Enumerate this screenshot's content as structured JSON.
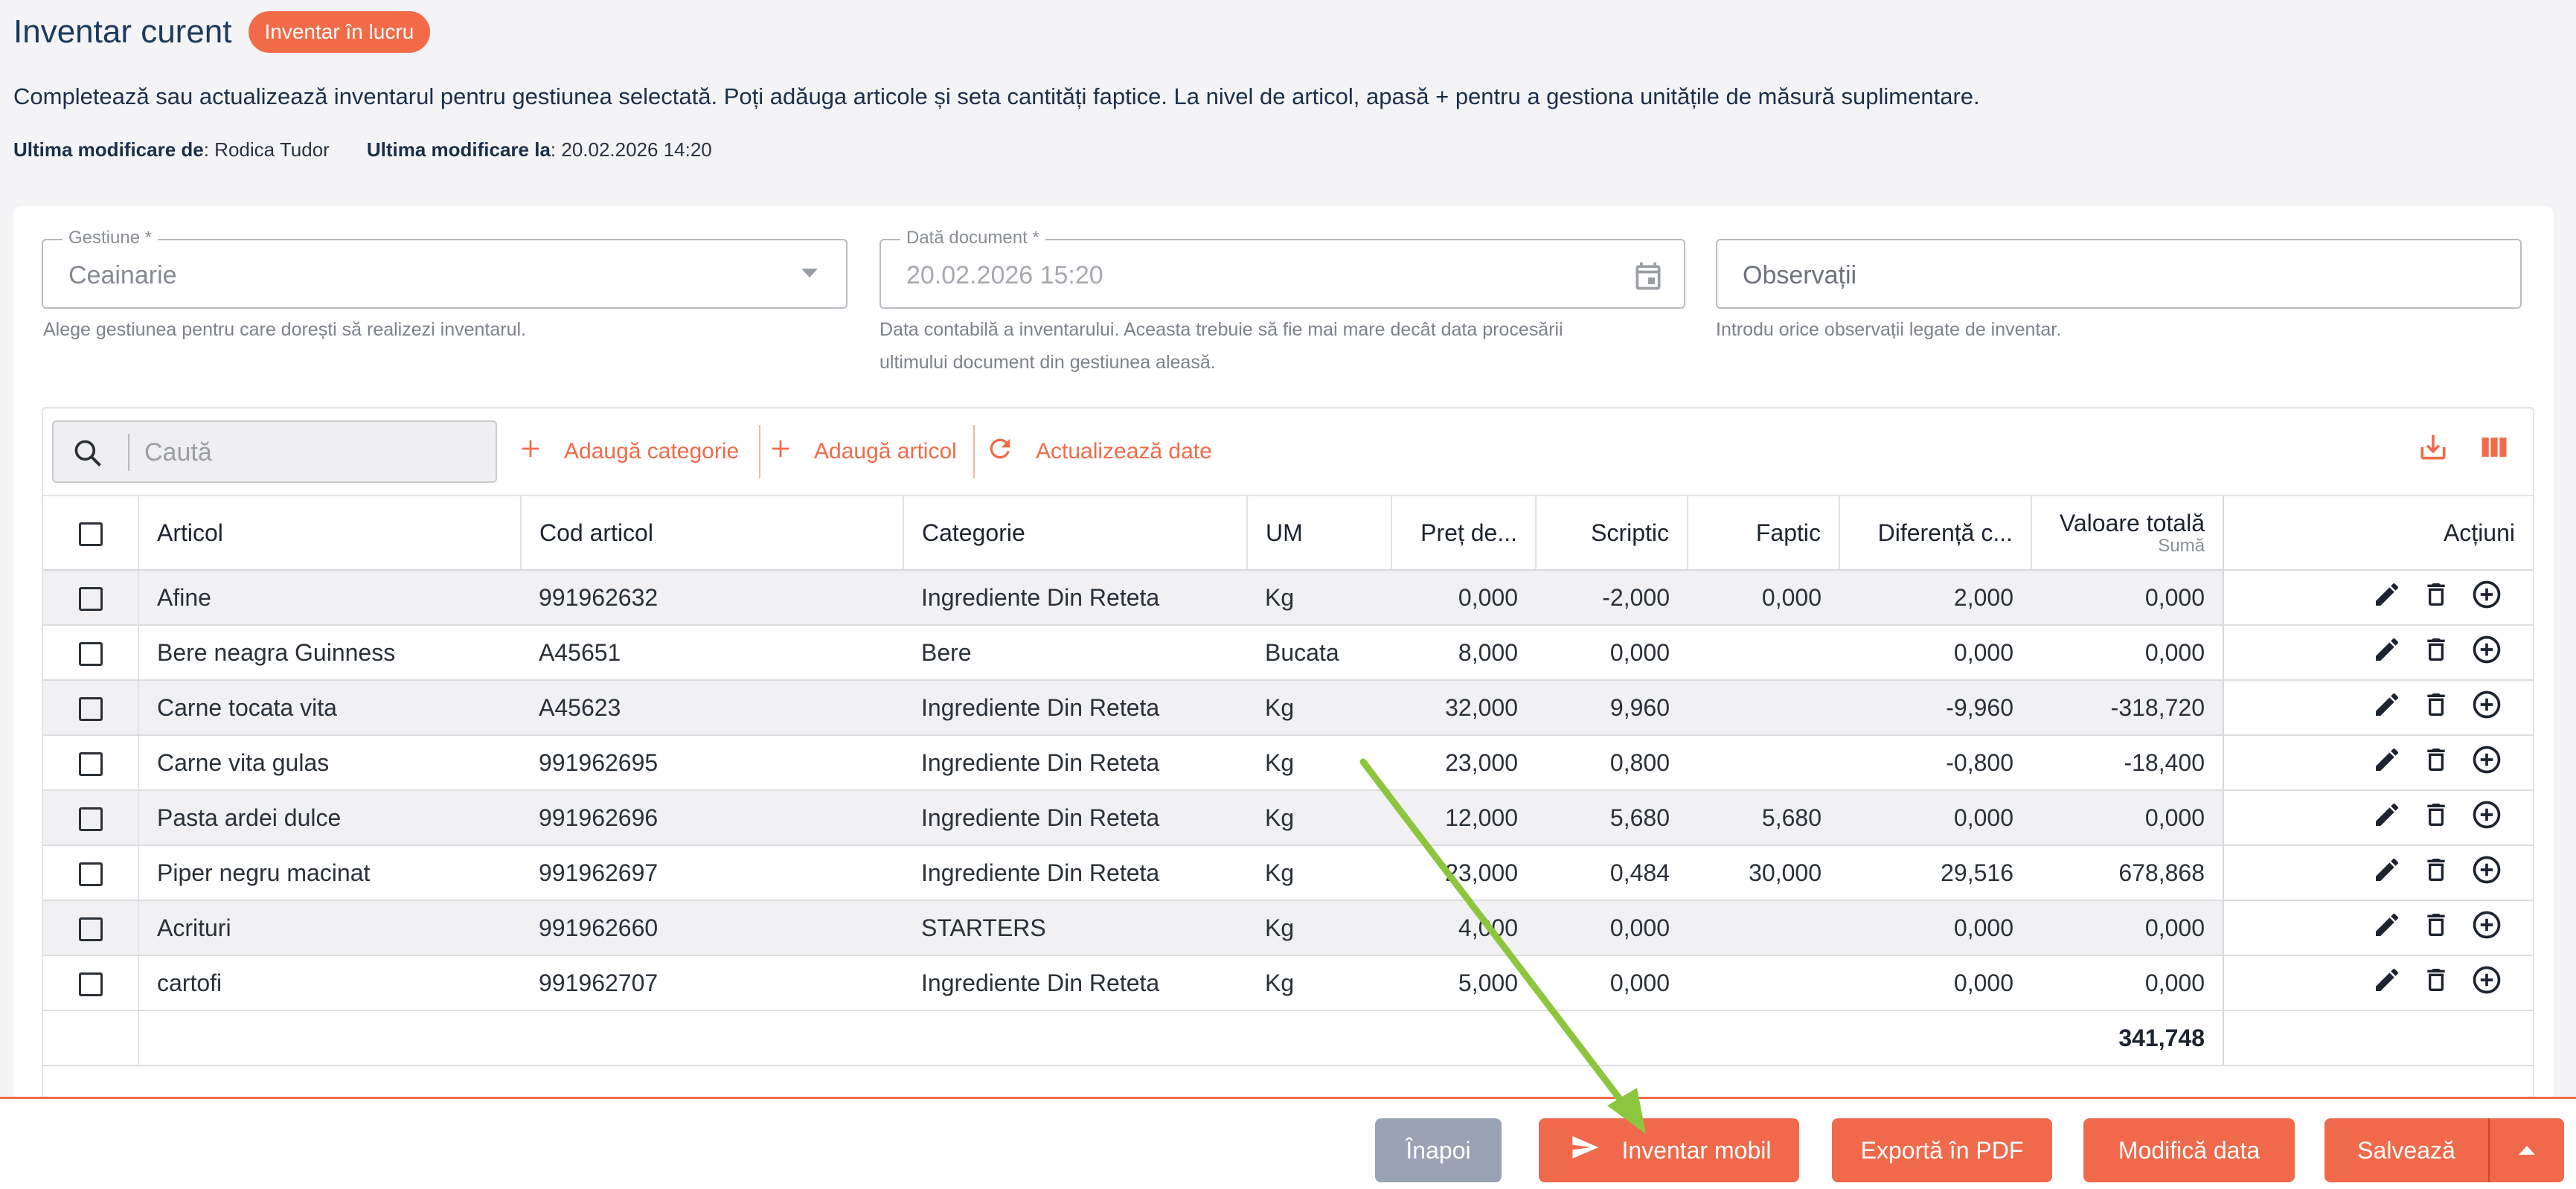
{
  "header": {
    "title": "Inventar curent",
    "status_badge": "Inventar în lucru",
    "description": "Completează sau actualizează inventarul pentru gestiunea selectată. Poți adăuga articole și seta cantități faptice. La nivel de articol, apasă + pentru a gestiona unitățile de măsură suplimentare.",
    "last_modified_by_label": "Ultima modificare de",
    "last_modified_by": ": Rodica Tudor",
    "last_modified_at_label": "Ultima modificare la",
    "last_modified_at": ": 20.02.2026 14:20"
  },
  "form": {
    "gestiune": {
      "label": "Gestiune *",
      "value": "Ceainarie",
      "helper": "Alege gestiunea pentru care dorești să realizezi inventarul."
    },
    "data_document": {
      "label": "Dată document *",
      "value": "20.02.2026 15:20",
      "helper_line1": "Data contabilă a inventarului. Aceasta trebuie să fie mai mare decât data procesării",
      "helper_line2": "ultimului document din gestiunea aleasă."
    },
    "observatii": {
      "placeholder": "Observații",
      "helper": "Introdu orice observații legate de inventar."
    }
  },
  "toolbar": {
    "search_placeholder": "Caută",
    "add_category": "Adaugă categorie",
    "add_article": "Adaugă articol",
    "refresh": "Actualizează date",
    "download_icon": "download-icon",
    "columns_icon": "columns-icon"
  },
  "table": {
    "columns": {
      "articol": "Articol",
      "cod": "Cod articol",
      "categorie": "Categorie",
      "um": "UM",
      "pret": "Preț de...",
      "scriptic": "Scriptic",
      "faptic": "Faptic",
      "diferenta": "Diferență c...",
      "valoare": "Valoare totală",
      "valoare_sub": "Sumă",
      "actiuni": "Acțiuni"
    },
    "rows": [
      {
        "articol": "Afine",
        "cod": "991962632",
        "categorie": "Ingrediente Din Reteta",
        "um": "Kg",
        "pret": "0,000",
        "scriptic": "-2,000",
        "faptic": "0,000",
        "diferenta": "2,000",
        "valoare": "0,000"
      },
      {
        "articol": "Bere neagra Guinness",
        "cod": "A45651",
        "categorie": "Bere",
        "um": "Bucata",
        "pret": "8,000",
        "scriptic": "0,000",
        "faptic": "",
        "diferenta": "0,000",
        "valoare": "0,000"
      },
      {
        "articol": "Carne tocata vita",
        "cod": "A45623",
        "categorie": "Ingrediente Din Reteta",
        "um": "Kg",
        "pret": "32,000",
        "scriptic": "9,960",
        "faptic": "",
        "diferenta": "-9,960",
        "valoare": "-318,720"
      },
      {
        "articol": "Carne vita gulas",
        "cod": "991962695",
        "categorie": "Ingrediente Din Reteta",
        "um": "Kg",
        "pret": "23,000",
        "scriptic": "0,800",
        "faptic": "",
        "diferenta": "-0,800",
        "valoare": "-18,400"
      },
      {
        "articol": "Pasta ardei dulce",
        "cod": "991962696",
        "categorie": "Ingrediente Din Reteta",
        "um": "Kg",
        "pret": "12,000",
        "scriptic": "5,680",
        "faptic": "5,680",
        "diferenta": "0,000",
        "valoare": "0,000"
      },
      {
        "articol": "Piper negru macinat",
        "cod": "991962697",
        "categorie": "Ingrediente Din Reteta",
        "um": "Kg",
        "pret": "23,000",
        "scriptic": "0,484",
        "faptic": "30,000",
        "diferenta": "29,516",
        "valoare": "678,868"
      },
      {
        "articol": "Acrituri",
        "cod": "991962660",
        "categorie": "STARTERS",
        "um": "Kg",
        "pret": "4,000",
        "scriptic": "0,000",
        "faptic": "",
        "diferenta": "0,000",
        "valoare": "0,000"
      },
      {
        "articol": "cartofi",
        "cod": "991962707",
        "categorie": "Ingrediente Din Reteta",
        "um": "Kg",
        "pret": "5,000",
        "scriptic": "0,000",
        "faptic": "",
        "diferenta": "0,000",
        "valoare": "0,000"
      }
    ],
    "total": "341,748",
    "row_action_icons": [
      "edit-icon",
      "delete-icon",
      "add-circle-icon"
    ]
  },
  "footer": {
    "back": "Înapoi",
    "mobile_inventory": "Inventar mobil",
    "export_pdf": "Exportă în PDF",
    "change_date": "Modifică data",
    "save": "Salvează"
  },
  "colors": {
    "accent": "#f26b48",
    "title": "#1c3a5e",
    "back_button": "#9aa3b4",
    "annotation_arrow": "#8cc63f"
  }
}
